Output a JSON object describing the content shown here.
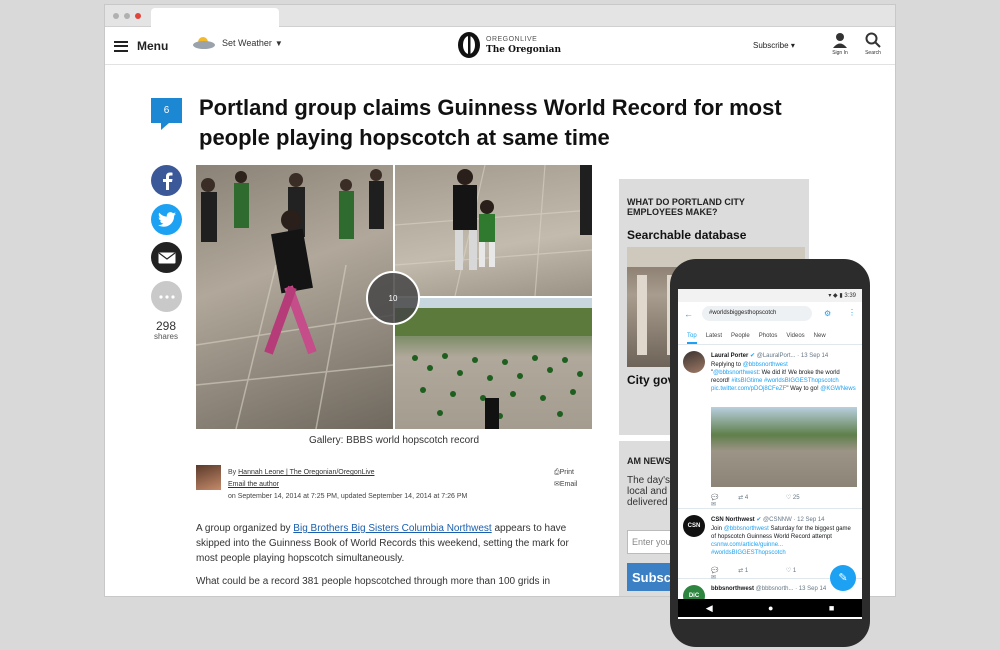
{
  "header": {
    "menu_label": "Menu",
    "weather_label": "Set Weather",
    "logo_top": "OREGONLIVE",
    "logo_bottom": "The Oregonian",
    "subscribe_label": "Subscribe",
    "signin_label": "Sign In",
    "search_label": "Search"
  },
  "article": {
    "comment_count": "6",
    "headline": "Portland group claims Guinness World Record for most people playing hopscotch at same time",
    "shares_count": "298",
    "shares_label": "shares",
    "gallery_count": "10",
    "gallery_caption": "Gallery: BBBS world hopscotch record",
    "byline_prefix": "By ",
    "author": "Hannah Leone | The Oregonian/OregonLive",
    "email_author": "Email the author",
    "dateline": "on September 14, 2014 at 7:25 PM, updated September 14, 2014 at 7:26 PM",
    "print_label": "Print",
    "email_label": "Email",
    "p1_before": "A group organized by ",
    "p1_link": "Big Brothers Big Sisters Columbia Northwest",
    "p1_after": " appears to have skipped into the Guinness Book of World Records this weekend, setting the mark for most people playing hopscotch simultaneously.",
    "p2": "What could be a record 381 people hopscotched through more than 100 grids in"
  },
  "sidebar": {
    "kicker": "WHAT DO PORTLAND CITY EMPLOYEES MAKE?",
    "title": "Searchable database",
    "teaser": "City gov",
    "box2_title": "AM NEWS",
    "box2_text": "The day's local and n delivered",
    "input_placeholder": "Enter your",
    "button_label": "Subsc"
  },
  "phone": {
    "time": "3:39",
    "search_query": "#worldsbiggesthopscotch",
    "tabs": [
      "Top",
      "Latest",
      "People",
      "Photos",
      "Videos",
      "New"
    ],
    "tweets": [
      {
        "name": "Laural Porter",
        "handle": "@LauralPort...",
        "date": "13 Sep 14",
        "replying_prefix": "Replying to ",
        "replying_to": "@bbbsnorthwest",
        "text_open": "\"",
        "text_mention": "@bbbsnorthwest",
        "text_main": ": We did it! We broke the world record! ",
        "hashtag1": "#itsBIGtime",
        "hashtag2": "#worldsBIGGESThopscotch",
        "link": "pic.twitter.com/pDOj8CFeZF",
        "text_end": "\" Way to go! ",
        "mention_end": "@KGWNews",
        "replies": "",
        "retweets": "4",
        "likes": "25"
      },
      {
        "name": "CSN Northwest",
        "handle": "@CSNNW",
        "date": "12 Sep 14",
        "avatar_text": "CSN",
        "text_a": "Join ",
        "mention": "@bbbsnorthwest",
        "text_b": " Saturday for the biggest game of hopscotch Guinness World Record attempt ",
        "link": "csnnw.com/article/guinne...",
        "hashtag": "#worldsBIGGESThopscotch",
        "retweets": "1",
        "likes": "1"
      },
      {
        "name": "bbbsnorthwest",
        "handle": "@bbbsnorth...",
        "date": "13 Sep 14",
        "avatar_text": "DiC"
      }
    ]
  }
}
